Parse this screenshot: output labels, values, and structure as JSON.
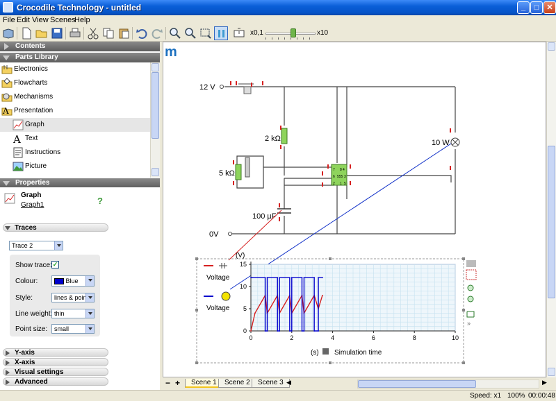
{
  "window": {
    "title": "Crocodile Technology - untitled"
  },
  "menu": [
    "File",
    "Edit",
    "View",
    "Scenes",
    "Help"
  ],
  "toolbar": {
    "zoom_min": "x0,1",
    "zoom_max": "x10",
    "zoom_level": 0.55
  },
  "left_panel": {
    "contents_header": "Contents",
    "parts_header": "Parts Library",
    "parts": [
      {
        "label": "Electronics",
        "icon": "folder-electronics-icon",
        "level": 0
      },
      {
        "label": "Flowcharts",
        "icon": "folder-flowcharts-icon",
        "level": 0
      },
      {
        "label": "Mechanisms",
        "icon": "folder-mechanisms-icon",
        "level": 0
      },
      {
        "label": "Presentation",
        "icon": "folder-presentation-icon",
        "level": 0
      },
      {
        "label": "Graph",
        "icon": "graph-icon",
        "level": 1
      },
      {
        "label": "Text",
        "icon": "text-icon",
        "level": 1
      },
      {
        "label": "Instructions",
        "icon": "instructions-icon",
        "level": 1
      },
      {
        "label": "Picture",
        "icon": "picture-icon",
        "level": 1
      }
    ],
    "properties_header": "Properties",
    "component_type": "Graph",
    "component_name": "Graph1",
    "help": "?",
    "traces_section": "Traces",
    "trace_select": "Trace 2",
    "show_trace_label": "Show trace:",
    "show_trace_checked": "✓",
    "colour_label": "Colour:",
    "colour_value": "Blue",
    "colour_hex": "#0000cc",
    "style_label": "Style:",
    "style_value": "lines & points",
    "line_weight_label": "Line weight:",
    "line_weight_value": "thin",
    "point_size_label": "Point size:",
    "point_size_value": "small",
    "sections": [
      "Y-axis",
      "X-axis",
      "Visual settings",
      "Advanced"
    ]
  },
  "circuit": {
    "v_supply": "12 V",
    "ground": "0V",
    "r1": "2 kΩ",
    "r2": "5 kΩ",
    "capacitor": "100 µF",
    "lamp": "10 W",
    "chip": "555",
    "chip_pins_left": [
      "7",
      "6",
      "2"
    ],
    "chip_pins_right": [
      "4",
      "8",
      "3",
      "1",
      "5"
    ]
  },
  "graph": {
    "y_unit": "(V)",
    "x_label": "Simulation time",
    "x_unit": "(s)",
    "legend": [
      {
        "label": "Voltage",
        "color": "#d62020"
      },
      {
        "label": "Voltage",
        "color": "#0000cc"
      }
    ]
  },
  "chart_data": {
    "type": "line",
    "xlabel": "Simulation time",
    "ylabel": "(V)",
    "xlim": [
      0,
      10
    ],
    "ylim": [
      0,
      15
    ],
    "x_ticks": [
      0,
      2,
      4,
      6,
      8,
      10
    ],
    "y_ticks": [
      0,
      5,
      10,
      15
    ],
    "series": [
      {
        "name": "Voltage",
        "color": "#d62020",
        "x": [
          0,
          0.2,
          0.7,
          0.8,
          1.3,
          1.4,
          1.9,
          2.0,
          2.5,
          2.6,
          3.1,
          3.3,
          3.5
        ],
        "y": [
          0,
          4,
          8,
          4,
          8,
          4,
          8,
          4,
          8,
          4,
          8,
          5,
          8
        ]
      },
      {
        "name": "Voltage",
        "color": "#0000cc",
        "x": [
          0,
          0.05,
          0.7,
          0.7,
          0.8,
          0.8,
          1.3,
          1.3,
          1.4,
          1.4,
          1.9,
          1.9,
          2.0,
          2.0,
          2.5,
          2.5,
          2.6,
          2.6,
          3.1,
          3.1,
          3.3,
          3.3,
          3.5
        ],
        "y": [
          12,
          12,
          12,
          0,
          0,
          12,
          12,
          0,
          0,
          12,
          12,
          0,
          0,
          12,
          12,
          0,
          0,
          12,
          12,
          0,
          0,
          12,
          12
        ]
      }
    ]
  },
  "scenes": [
    "Scene 1",
    "Scene 2",
    "Scene 3"
  ],
  "scene_controls": {
    "remove": "−",
    "add": "+"
  },
  "status": {
    "speed": "Speed: x1",
    "zoom": "100%",
    "time": "00:00:48"
  }
}
